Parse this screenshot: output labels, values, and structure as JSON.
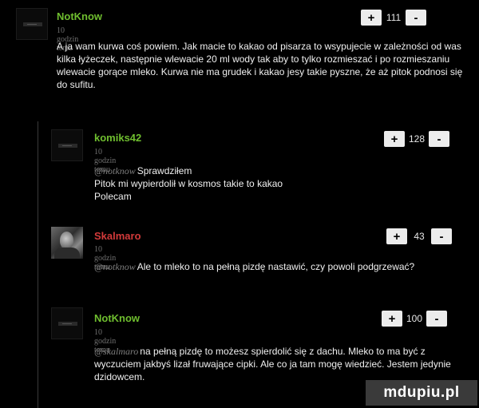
{
  "comments": [
    {
      "username": "NotKnow",
      "time": "10 godzin temu",
      "mention": "",
      "text": "A ja wam kurwa coś powiem. Jak macie to kakao od pisarza to wsypujecie w zależności od was kilka łyżeczek, następnie wlewacie 20 ml wody tak aby to tylko rozmieszać i po rozmieszaniu wlewacie gorące mleko. Kurwa nie ma grudek i kakao jesy takie pyszne, że aż pitok podnosi się do sufitu.",
      "votes": "111"
    },
    {
      "username": "komiks42",
      "time": "10 godzin temu",
      "mention": "@notknow",
      "text_lines": [
        "Sprawdziłem",
        "Pitok mi wypierdolił w kosmos takie to kakao",
        "Polecam"
      ],
      "votes": "128"
    },
    {
      "username": "Skalmaro",
      "time": "10 godzin temu",
      "mention": "@notknow",
      "text": "Ale to mleko to na pełną pizdę nastawić, czy powoli podgrzewać?",
      "votes": "43"
    },
    {
      "username": "NotKnow",
      "time": "10 godzin temu",
      "mention": "@skalmaro",
      "text": "na pełną pizdę to możesz spierdolić się z dachu. Mleko to ma być z wyczuciem jakbyś lizał fruwające cipki. Ale co ja tam mogę wiedzieć. Jestem jedynie dzidowcem.",
      "votes": "100"
    }
  ],
  "vote": {
    "plus": "+",
    "minus": "-"
  },
  "watermark": "mdupiu.pl",
  "colors": {
    "username": "#6fbe2f",
    "username_alt": "#d23a3a",
    "timestamp": "#6f6f6f",
    "background": "#000000"
  }
}
